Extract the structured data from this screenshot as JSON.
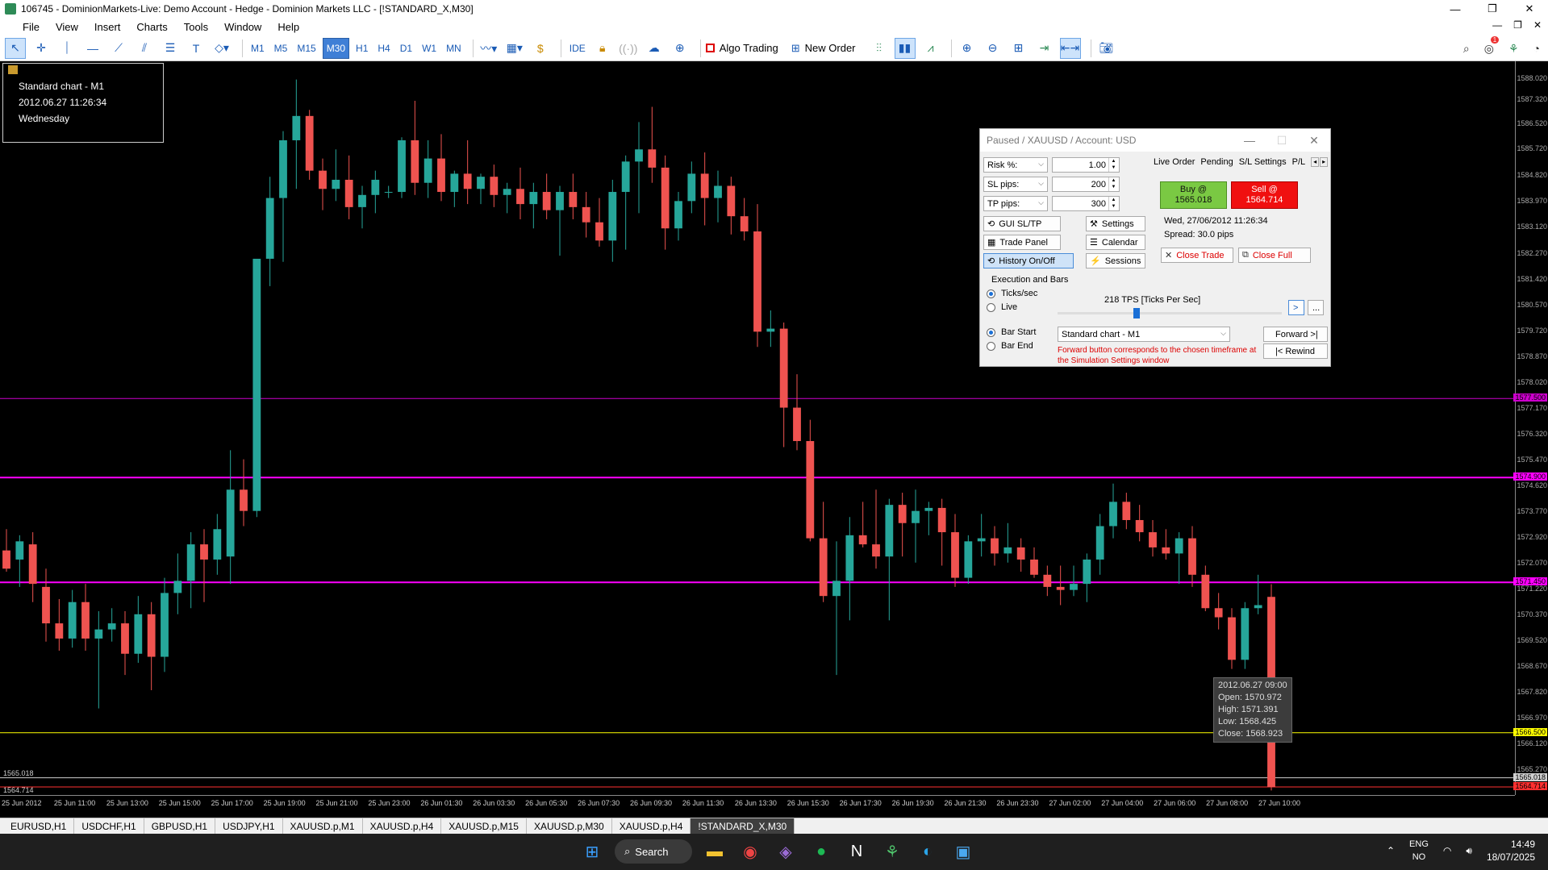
{
  "window": {
    "title": "106745 - DominionMarkets-Live: Demo Account - Hedge - Dominion Markets LLC - [!STANDARD_X,M30]",
    "controls": [
      "—",
      "❐",
      "✕"
    ]
  },
  "menu": [
    "File",
    "View",
    "Insert",
    "Charts",
    "Tools",
    "Window",
    "Help"
  ],
  "toolbar": {
    "timeframes": [
      "M1",
      "M5",
      "M15",
      "M30",
      "H1",
      "H4",
      "D1",
      "W1",
      "MN"
    ],
    "selected_timeframe": "M30",
    "ide_label": "IDE",
    "algo_trading_label": "Algo Trading",
    "new_order_label": "New Order",
    "notification_count": "1"
  },
  "infobox": {
    "line1": "Standard chart - M1",
    "line2": "2012.06.27 11:26:34",
    "line3": "Wednesday"
  },
  "chart_data": {
    "type": "candlestick",
    "symbol": "!STANDARD_X",
    "timeframe": "M30",
    "ylim": [
      1564.45,
      1588.6
    ],
    "price_ticks": [
      "1588.020",
      "1587.320",
      "1586.520",
      "1585.720",
      "1584.820",
      "1583.970",
      "1583.120",
      "1582.270",
      "1581.420",
      "1580.570",
      "1579.720",
      "1578.870",
      "1578.020",
      "1577.170",
      "1576.320",
      "1575.470",
      "1574.620",
      "1573.770",
      "1572.920",
      "1572.070",
      "1571.220",
      "1570.370",
      "1569.520",
      "1568.670",
      "1567.820",
      "1566.970",
      "1566.120",
      "1565.270"
    ],
    "time_labels": [
      "25 Jun 2012",
      "25 Jun 11:00",
      "25 Jun 13:00",
      "25 Jun 15:00",
      "25 Jun 17:00",
      "25 Jun 19:00",
      "25 Jun 21:00",
      "25 Jun 23:00",
      "26 Jun 01:30",
      "26 Jun 03:30",
      "26 Jun 05:30",
      "26 Jun 07:30",
      "26 Jun 09:30",
      "26 Jun 11:30",
      "26 Jun 13:30",
      "26 Jun 15:30",
      "26 Jun 17:30",
      "26 Jun 19:30",
      "26 Jun 21:30",
      "26 Jun 23:30",
      "27 Jun 02:00",
      "27 Jun 04:00",
      "27 Jun 06:00",
      "27 Jun 08:00",
      "27 Jun 10:00"
    ],
    "candles": [
      {
        "o": 1572.5,
        "h": 1573.2,
        "l": 1571.8,
        "c": 1571.9
      },
      {
        "o": 1572.2,
        "h": 1573.0,
        "l": 1571.3,
        "c": 1572.8
      },
      {
        "o": 1572.7,
        "h": 1573.1,
        "l": 1570.8,
        "c": 1571.4
      },
      {
        "o": 1571.3,
        "h": 1571.9,
        "l": 1569.5,
        "c": 1570.1
      },
      {
        "o": 1570.1,
        "h": 1570.9,
        "l": 1569.2,
        "c": 1569.6
      },
      {
        "o": 1569.6,
        "h": 1571.2,
        "l": 1569.3,
        "c": 1570.8
      },
      {
        "o": 1570.8,
        "h": 1571.4,
        "l": 1569.2,
        "c": 1569.6
      },
      {
        "o": 1569.6,
        "h": 1570.5,
        "l": 1567.3,
        "c": 1569.9
      },
      {
        "o": 1569.9,
        "h": 1570.6,
        "l": 1569.5,
        "c": 1570.1
      },
      {
        "o": 1570.1,
        "h": 1570.5,
        "l": 1568.4,
        "c": 1569.1
      },
      {
        "o": 1569.1,
        "h": 1571.0,
        "l": 1568.8,
        "c": 1570.4
      },
      {
        "o": 1570.4,
        "h": 1570.8,
        "l": 1567.9,
        "c": 1569.0
      },
      {
        "o": 1569.0,
        "h": 1571.6,
        "l": 1568.5,
        "c": 1571.1
      },
      {
        "o": 1571.1,
        "h": 1572.4,
        "l": 1570.4,
        "c": 1571.5
      },
      {
        "o": 1571.5,
        "h": 1573.1,
        "l": 1570.6,
        "c": 1572.7
      },
      {
        "o": 1572.7,
        "h": 1573.2,
        "l": 1570.8,
        "c": 1572.2
      },
      {
        "o": 1572.2,
        "h": 1573.7,
        "l": 1571.7,
        "c": 1573.2
      },
      {
        "o": 1572.3,
        "h": 1575.8,
        "l": 1571.4,
        "c": 1574.5
      },
      {
        "o": 1574.5,
        "h": 1575.5,
        "l": 1573.3,
        "c": 1573.8
      },
      {
        "o": 1573.8,
        "h": 1582.0,
        "l": 1573.6,
        "c": 1582.1
      },
      {
        "o": 1582.1,
        "h": 1584.8,
        "l": 1581.2,
        "c": 1584.1
      },
      {
        "o": 1584.1,
        "h": 1586.3,
        "l": 1582.0,
        "c": 1586.0
      },
      {
        "o": 1586.0,
        "h": 1588.0,
        "l": 1584.4,
        "c": 1586.8
      },
      {
        "o": 1586.8,
        "h": 1587.0,
        "l": 1584.7,
        "c": 1585.0
      },
      {
        "o": 1585.0,
        "h": 1585.4,
        "l": 1583.7,
        "c": 1584.4
      },
      {
        "o": 1584.4,
        "h": 1585.7,
        "l": 1584.0,
        "c": 1584.7
      },
      {
        "o": 1584.7,
        "h": 1585.5,
        "l": 1583.4,
        "c": 1583.8
      },
      {
        "o": 1583.8,
        "h": 1584.5,
        "l": 1583.1,
        "c": 1584.2
      },
      {
        "o": 1584.2,
        "h": 1585.0,
        "l": 1583.6,
        "c": 1584.7
      },
      {
        "o": 1584.3,
        "h": 1584.5,
        "l": 1584.1,
        "c": 1584.3
      },
      {
        "o": 1584.3,
        "h": 1586.1,
        "l": 1584.1,
        "c": 1586.0
      },
      {
        "o": 1586.0,
        "h": 1587.3,
        "l": 1584.2,
        "c": 1584.6
      },
      {
        "o": 1584.6,
        "h": 1586.0,
        "l": 1584.1,
        "c": 1585.4
      },
      {
        "o": 1585.4,
        "h": 1586.2,
        "l": 1584.0,
        "c": 1584.3
      },
      {
        "o": 1584.3,
        "h": 1585.0,
        "l": 1583.8,
        "c": 1584.9
      },
      {
        "o": 1584.9,
        "h": 1586.0,
        "l": 1583.9,
        "c": 1584.4
      },
      {
        "o": 1584.4,
        "h": 1584.9,
        "l": 1583.9,
        "c": 1584.8
      },
      {
        "o": 1584.8,
        "h": 1585.2,
        "l": 1583.8,
        "c": 1584.2
      },
      {
        "o": 1584.2,
        "h": 1584.6,
        "l": 1583.6,
        "c": 1584.4
      },
      {
        "o": 1584.4,
        "h": 1585.1,
        "l": 1583.4,
        "c": 1583.9
      },
      {
        "o": 1583.9,
        "h": 1584.6,
        "l": 1583.1,
        "c": 1584.3
      },
      {
        "o": 1584.3,
        "h": 1584.9,
        "l": 1583.4,
        "c": 1583.7
      },
      {
        "o": 1583.7,
        "h": 1584.5,
        "l": 1582.2,
        "c": 1584.3
      },
      {
        "o": 1584.3,
        "h": 1584.9,
        "l": 1583.4,
        "c": 1583.8
      },
      {
        "o": 1583.8,
        "h": 1584.3,
        "l": 1582.8,
        "c": 1583.3
      },
      {
        "o": 1583.3,
        "h": 1584.1,
        "l": 1582.5,
        "c": 1582.7
      },
      {
        "o": 1582.7,
        "h": 1584.7,
        "l": 1582.0,
        "c": 1584.3
      },
      {
        "o": 1584.3,
        "h": 1585.5,
        "l": 1582.4,
        "c": 1585.3
      },
      {
        "o": 1585.3,
        "h": 1586.6,
        "l": 1583.6,
        "c": 1585.7
      },
      {
        "o": 1585.7,
        "h": 1587.1,
        "l": 1584.6,
        "c": 1585.1
      },
      {
        "o": 1585.1,
        "h": 1585.5,
        "l": 1582.4,
        "c": 1583.1
      },
      {
        "o": 1583.1,
        "h": 1584.3,
        "l": 1582.7,
        "c": 1584.0
      },
      {
        "o": 1584.0,
        "h": 1585.3,
        "l": 1583.6,
        "c": 1584.9
      },
      {
        "o": 1584.9,
        "h": 1585.6,
        "l": 1583.2,
        "c": 1584.1
      },
      {
        "o": 1584.1,
        "h": 1585.0,
        "l": 1583.3,
        "c": 1584.5
      },
      {
        "o": 1584.5,
        "h": 1584.8,
        "l": 1582.9,
        "c": 1583.5
      },
      {
        "o": 1583.5,
        "h": 1584.1,
        "l": 1582.7,
        "c": 1583.0
      },
      {
        "o": 1583.0,
        "h": 1583.9,
        "l": 1579.2,
        "c": 1579.7
      },
      {
        "o": 1579.7,
        "h": 1580.4,
        "l": 1579.2,
        "c": 1579.8
      },
      {
        "o": 1579.8,
        "h": 1580.0,
        "l": 1575.9,
        "c": 1577.2
      },
      {
        "o": 1577.2,
        "h": 1578.3,
        "l": 1575.8,
        "c": 1576.1
      },
      {
        "o": 1576.1,
        "h": 1576.8,
        "l": 1572.8,
        "c": 1572.9
      },
      {
        "o": 1572.9,
        "h": 1574.1,
        "l": 1570.8,
        "c": 1571.0
      },
      {
        "o": 1571.0,
        "h": 1572.8,
        "l": 1568.4,
        "c": 1571.5
      },
      {
        "o": 1571.5,
        "h": 1573.6,
        "l": 1570.2,
        "c": 1573.0
      },
      {
        "o": 1573.0,
        "h": 1574.1,
        "l": 1572.6,
        "c": 1572.7
      },
      {
        "o": 1572.7,
        "h": 1574.5,
        "l": 1571.9,
        "c": 1572.3
      },
      {
        "o": 1572.3,
        "h": 1574.2,
        "l": 1570.2,
        "c": 1574.0
      },
      {
        "o": 1574.0,
        "h": 1574.4,
        "l": 1572.3,
        "c": 1573.4
      },
      {
        "o": 1573.4,
        "h": 1574.5,
        "l": 1572.1,
        "c": 1573.8
      },
      {
        "o": 1573.8,
        "h": 1574.1,
        "l": 1573.0,
        "c": 1573.9
      },
      {
        "o": 1573.9,
        "h": 1574.2,
        "l": 1572.0,
        "c": 1573.1
      },
      {
        "o": 1573.1,
        "h": 1573.7,
        "l": 1571.3,
        "c": 1571.6
      },
      {
        "o": 1571.6,
        "h": 1573.0,
        "l": 1571.4,
        "c": 1572.8
      },
      {
        "o": 1572.8,
        "h": 1573.7,
        "l": 1572.3,
        "c": 1572.9
      },
      {
        "o": 1572.9,
        "h": 1573.3,
        "l": 1572.0,
        "c": 1572.4
      },
      {
        "o": 1572.4,
        "h": 1573.4,
        "l": 1572.1,
        "c": 1572.6
      },
      {
        "o": 1572.6,
        "h": 1572.9,
        "l": 1571.8,
        "c": 1572.2
      },
      {
        "o": 1572.2,
        "h": 1572.6,
        "l": 1571.6,
        "c": 1571.7
      },
      {
        "o": 1571.7,
        "h": 1572.0,
        "l": 1571.0,
        "c": 1571.3
      },
      {
        "o": 1571.3,
        "h": 1572.0,
        "l": 1570.7,
        "c": 1571.2
      },
      {
        "o": 1571.2,
        "h": 1572.0,
        "l": 1571.0,
        "c": 1571.4
      },
      {
        "o": 1571.4,
        "h": 1572.4,
        "l": 1570.8,
        "c": 1572.2
      },
      {
        "o": 1572.2,
        "h": 1573.7,
        "l": 1571.7,
        "c": 1573.3
      },
      {
        "o": 1573.3,
        "h": 1574.7,
        "l": 1572.9,
        "c": 1574.1
      },
      {
        "o": 1574.1,
        "h": 1574.4,
        "l": 1573.2,
        "c": 1573.5
      },
      {
        "o": 1573.5,
        "h": 1574.0,
        "l": 1572.8,
        "c": 1573.1
      },
      {
        "o": 1573.1,
        "h": 1573.5,
        "l": 1572.3,
        "c": 1572.6
      },
      {
        "o": 1572.6,
        "h": 1573.2,
        "l": 1572.2,
        "c": 1572.4
      },
      {
        "o": 1572.4,
        "h": 1573.1,
        "l": 1571.4,
        "c": 1572.9
      },
      {
        "o": 1572.9,
        "h": 1573.3,
        "l": 1571.3,
        "c": 1571.7
      },
      {
        "o": 1571.7,
        "h": 1572.0,
        "l": 1570.5,
        "c": 1570.6
      },
      {
        "o": 1570.6,
        "h": 1571.1,
        "l": 1569.9,
        "c": 1570.3
      },
      {
        "o": 1570.3,
        "h": 1570.6,
        "l": 1568.6,
        "c": 1568.9
      },
      {
        "o": 1568.9,
        "h": 1570.8,
        "l": 1568.6,
        "c": 1570.6
      },
      {
        "o": 1570.6,
        "h": 1571.7,
        "l": 1570.4,
        "c": 1570.7
      },
      {
        "o": 1570.972,
        "h": 1571.391,
        "l": 1564.6,
        "c": 1564.714
      }
    ],
    "hlines": [
      {
        "price": 1577.5,
        "color": "#cc00cc",
        "label": "1577.500"
      },
      {
        "price": 1574.9,
        "color": "#ff00ff",
        "label": "1574.900"
      },
      {
        "price": 1571.45,
        "color": "#ff00ff",
        "label": "1571.450"
      },
      {
        "price": 1566.5,
        "color": "#ffff00",
        "label": "1566.500"
      },
      {
        "price": 1565.018,
        "color": "#d0d0d0",
        "label": "1565.018"
      },
      {
        "price": 1564.714,
        "color": "#ff3030",
        "label": "1564.714"
      }
    ],
    "bull_color": "#26a69a",
    "bear_color": "#ef5350"
  },
  "tooltip": {
    "date": "2012.06.27 09:00",
    "open": "Open: 1570.972",
    "high": "High: 1571.391",
    "low": "Low: 1568.425",
    "close": "Close: 1568.923"
  },
  "dialog": {
    "title": "Paused / XAUUSD / Account: USD",
    "risk_label": "Risk %:",
    "risk_value": "1.00",
    "sl_label": "SL pips:",
    "sl_value": "200",
    "tp_label": "TP pips:",
    "tp_value": "300",
    "btn_gui": "GUI SL/TP",
    "btn_settings": "Settings",
    "btn_trade_panel": "Trade Panel",
    "btn_calendar": "Calendar",
    "btn_history": "History On/Off",
    "btn_sessions": "Sessions",
    "tabs": [
      "Live Order",
      "Pending",
      "S/L Settings",
      "P/L"
    ],
    "buy_line1": "Buy @",
    "buy_line2": "1565.018",
    "sell_line1": "Sell @",
    "sell_line2": "1564.714",
    "datetime": "Wed, 27/06/2012  11:26:34",
    "spread": "Spread: 30.0 pips",
    "close_trade": "Close Trade",
    "close_full": "Close Full",
    "exec_title": "Execution and Bars",
    "ticks_label": "Ticks/sec",
    "live_label": "Live",
    "tps": "218 TPS [Ticks Per Sec]",
    "bar_start": "Bar Start",
    "bar_end": "Bar End",
    "chart_select": "Standard chart - M1",
    "forward": "Forward >|",
    "rewind": "|< Rewind",
    "note": "Forward button corresponds to the chosen timeframe at the Simulation Settings window"
  },
  "chart_tabs": [
    "EURUSD,H1",
    "USDCHF,H1",
    "GBPUSD,H1",
    "USDJPY,H1",
    "XAUUSD.p,M1",
    "XAUUSD.p,H4",
    "XAUUSD.p,M15",
    "XAUUSD.p,M30",
    "XAUUSD.p,H4",
    "!STANDARD_X,M30"
  ],
  "taskbar": {
    "search": "Search",
    "lang1": "ENG",
    "lang2": "NO",
    "time": "14:49",
    "date": "18/07/2025"
  }
}
